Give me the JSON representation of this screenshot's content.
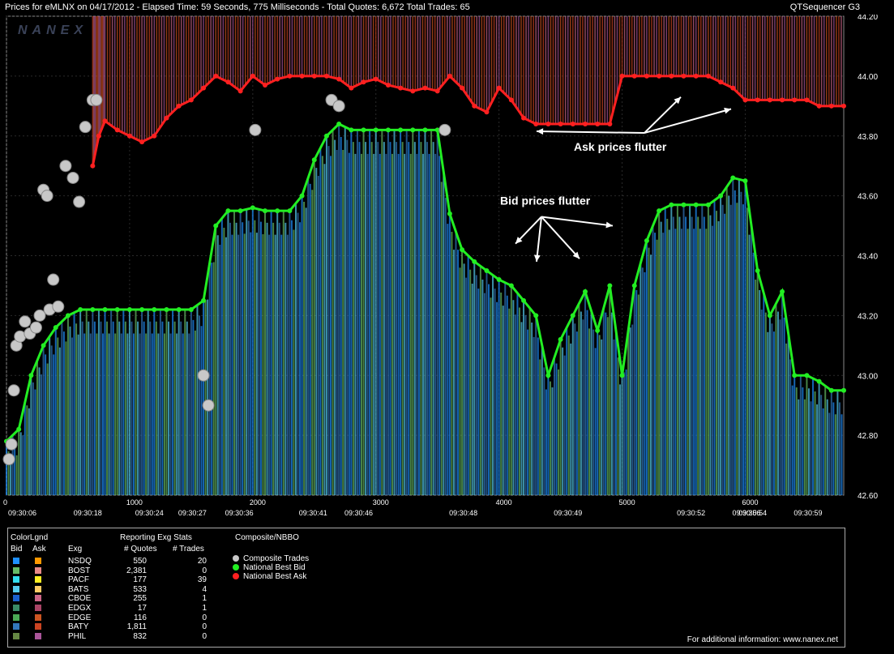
{
  "header": {
    "title": "Prices for  eMLNX  on  04/17/2012  -  Elapsed Time: 59 Seconds, 775 Milliseconds  -  Total Quotes: 6,672  Total Trades: 65",
    "app": "QTSequencer G3"
  },
  "watermark": "NANEX",
  "annotations": {
    "ask": "Ask prices flutter",
    "bid": "Bid prices flutter"
  },
  "chart_data": {
    "type": "line",
    "title": "",
    "ylim": [
      42.6,
      44.2
    ],
    "xlim": [
      0,
      6800
    ],
    "y_ticks": [
      "44.20",
      "44.00",
      "43.80",
      "43.60",
      "43.40",
      "43.20",
      "43.00",
      "42.80",
      "42.60"
    ],
    "x_seq_ticks": [
      "0",
      "1000",
      "2000",
      "3000",
      "4000",
      "5000",
      "6000"
    ],
    "x_time_ticks": [
      {
        "seq": 0,
        "label": "09:30:06"
      },
      {
        "seq": 650,
        "label": "09:30:18"
      },
      {
        "seq": 1150,
        "label": "09:30:24"
      },
      {
        "seq": 1500,
        "label": "09:30:27"
      },
      {
        "seq": 1880,
        "label": "09:30:36"
      },
      {
        "seq": 2480,
        "label": "09:30:41"
      },
      {
        "seq": 2850,
        "label": "09:30:46"
      },
      {
        "seq": 3700,
        "label": "09:30:48"
      },
      {
        "seq": 4550,
        "label": "09:30:49"
      },
      {
        "seq": 5550,
        "label": "09:30:52"
      },
      {
        "seq": 6050,
        "label": "09:30:54"
      },
      {
        "seq": 6000,
        "label": "09:30:56"
      },
      {
        "seq": 6500,
        "label": "09:30:59"
      }
    ],
    "grid": true,
    "series": [
      {
        "name": "National Best Ask",
        "color": "#ff2020",
        "x": [
          700,
          750,
          800,
          900,
          1000,
          1100,
          1200,
          1300,
          1400,
          1500,
          1600,
          1700,
          1800,
          1900,
          2000,
          2100,
          2200,
          2300,
          2400,
          2500,
          2600,
          2700,
          2800,
          2900,
          3000,
          3100,
          3200,
          3300,
          3400,
          3500,
          3600,
          3700,
          3800,
          3900,
          4000,
          4100,
          4200,
          4300,
          4400,
          4500,
          4600,
          4700,
          4800,
          4900,
          5000,
          5100,
          5200,
          5300,
          5400,
          5500,
          5600,
          5700,
          5800,
          5900,
          6000,
          6100,
          6200,
          6300,
          6400,
          6500,
          6600,
          6700,
          6800
        ],
        "y": [
          43.7,
          43.8,
          43.85,
          43.82,
          43.8,
          43.78,
          43.8,
          43.86,
          43.9,
          43.92,
          43.96,
          44.0,
          43.98,
          43.95,
          44.0,
          43.97,
          43.99,
          44.0,
          44.0,
          44.0,
          44.0,
          43.99,
          43.96,
          43.98,
          43.99,
          43.97,
          43.96,
          43.95,
          43.96,
          43.95,
          44.0,
          43.96,
          43.9,
          43.88,
          43.96,
          43.92,
          43.86,
          43.84,
          43.84,
          43.84,
          43.84,
          43.84,
          43.84,
          43.84,
          44.0,
          44.0,
          44.0,
          44.0,
          44.0,
          44.0,
          44.0,
          44.0,
          43.98,
          43.96,
          43.92,
          43.92,
          43.92,
          43.92,
          43.92,
          43.92,
          43.9,
          43.9,
          43.9
        ]
      },
      {
        "name": "National Best Bid",
        "color": "#22ee22",
        "x": [
          0,
          100,
          200,
          300,
          400,
          500,
          600,
          700,
          800,
          900,
          1000,
          1100,
          1200,
          1300,
          1400,
          1500,
          1600,
          1700,
          1800,
          1900,
          2000,
          2100,
          2200,
          2300,
          2400,
          2500,
          2600,
          2700,
          2800,
          2900,
          3000,
          3100,
          3200,
          3300,
          3400,
          3500,
          3600,
          3700,
          3800,
          3900,
          4000,
          4100,
          4200,
          4300,
          4400,
          4500,
          4600,
          4700,
          4800,
          4900,
          5000,
          5100,
          5200,
          5300,
          5400,
          5500,
          5600,
          5700,
          5800,
          5900,
          6000,
          6100,
          6200,
          6300,
          6400,
          6500,
          6600,
          6700,
          6800
        ],
        "y": [
          42.78,
          42.82,
          43.0,
          43.1,
          43.16,
          43.2,
          43.22,
          43.22,
          43.22,
          43.22,
          43.22,
          43.22,
          43.22,
          43.22,
          43.22,
          43.22,
          43.25,
          43.5,
          43.55,
          43.55,
          43.56,
          43.55,
          43.55,
          43.55,
          43.6,
          43.72,
          43.8,
          43.84,
          43.82,
          43.82,
          43.82,
          43.82,
          43.82,
          43.82,
          43.82,
          43.82,
          43.54,
          43.42,
          43.38,
          43.35,
          43.32,
          43.3,
          43.25,
          43.2,
          43.0,
          43.12,
          43.2,
          43.28,
          43.15,
          43.3,
          43.0,
          43.3,
          43.45,
          43.55,
          43.57,
          43.57,
          43.57,
          43.57,
          43.6,
          43.66,
          43.65,
          43.35,
          43.2,
          43.28,
          43.0,
          43.0,
          42.98,
          42.95,
          42.95
        ]
      },
      {
        "name": "Composite Trades",
        "color": "#c8c8c8",
        "x": [
          20,
          40,
          60,
          80,
          110,
          150,
          190,
          240,
          270,
          300,
          330,
          350,
          380,
          420,
          480,
          540,
          590,
          640,
          700,
          730,
          1600,
          1640,
          2020,
          2640,
          2700,
          3560
        ],
        "y": [
          42.72,
          42.77,
          42.95,
          43.1,
          43.13,
          43.18,
          43.14,
          43.16,
          43.2,
          43.62,
          43.6,
          43.22,
          43.32,
          43.23,
          43.7,
          43.66,
          43.58,
          43.83,
          43.92,
          43.92,
          43.0,
          42.9,
          43.82,
          43.92,
          43.9,
          43.82
        ]
      }
    ]
  },
  "legend": {
    "col_headers": {
      "colorlgnd": "ColorLgnd",
      "bid": "Bid",
      "ask": "Ask",
      "exg": "Exg",
      "stats": "Reporting Exg Stats",
      "quotes": "# Quotes",
      "trades": "# Trades",
      "composite": "Composite/NBBO"
    },
    "exchanges": [
      {
        "name": "NSDQ",
        "quotes": "550",
        "trades": "20",
        "bid": "#1e90ff",
        "ask": "#ff9900"
      },
      {
        "name": "BOST",
        "quotes": "2,381",
        "trades": "0",
        "bid": "#66bb66",
        "ask": "#e88888"
      },
      {
        "name": "PACF",
        "quotes": "177",
        "trades": "39",
        "bid": "#33ddee",
        "ask": "#ffee22"
      },
      {
        "name": "BATS",
        "quotes": "533",
        "trades": "4",
        "bid": "#55ccee",
        "ask": "#ffcc66"
      },
      {
        "name": "CBOE",
        "quotes": "255",
        "trades": "1",
        "bid": "#1a5fcc",
        "ask": "#cc6688"
      },
      {
        "name": "EDGX",
        "quotes": "17",
        "trades": "1",
        "bid": "#3a8a66",
        "ask": "#aa4466"
      },
      {
        "name": "EDGE",
        "quotes": "116",
        "trades": "0",
        "bid": "#4aaa55",
        "ask": "#cc5522"
      },
      {
        "name": "BATY",
        "quotes": "1,811",
        "trades": "0",
        "bid": "#3377bb",
        "ask": "#cc4422"
      },
      {
        "name": "PHIL",
        "quotes": "832",
        "trades": "0",
        "bid": "#668844",
        "ask": "#aa5599"
      }
    ],
    "composite": [
      {
        "label": "Composite Trades",
        "color": "#c8c8c8"
      },
      {
        "label": "National Best Bid",
        "color": "#22ee22"
      },
      {
        "label": "National Best Ask",
        "color": "#ff2020"
      }
    ],
    "footer": "For additional information: www.nanex.net"
  }
}
